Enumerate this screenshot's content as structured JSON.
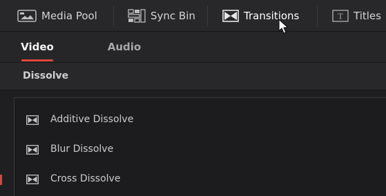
{
  "toolbar": {
    "media_pool": {
      "label": "Media Pool",
      "icon": "media-pool-icon"
    },
    "sync_bin": {
      "label": "Sync Bin",
      "icon": "sync-bin-icon"
    },
    "transitions": {
      "label": "Transitions",
      "icon": "transitions-icon",
      "active": true
    },
    "titles": {
      "label": "Titles",
      "icon": "titles-icon"
    }
  },
  "subtabs": [
    {
      "label": "Video",
      "active": true
    },
    {
      "label": "Audio",
      "active": false
    }
  ],
  "section": {
    "title": "Dissolve"
  },
  "items": [
    {
      "label": "Additive Dissolve",
      "icon": "transition-icon"
    },
    {
      "label": "Blur Dissolve",
      "icon": "transition-icon"
    },
    {
      "label": "Cross Dissolve",
      "icon": "transition-icon",
      "marked": true
    }
  ],
  "colors": {
    "accent": "#e0463c",
    "background": "#1f1f21",
    "toolbar": "#28282a"
  }
}
